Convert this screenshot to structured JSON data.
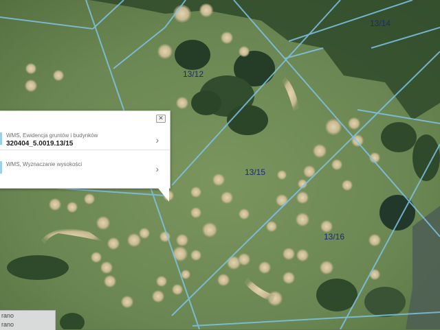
{
  "map": {
    "parcels": [
      {
        "id": "13/14",
        "label": "13/14"
      },
      {
        "id": "13/12",
        "label": "13/12"
      },
      {
        "id": "13/15",
        "label": "13/15"
      },
      {
        "id": "13/16",
        "label": "13/16"
      }
    ],
    "colors": {
      "boundary": "#7fc3e6",
      "label": "#1c2a6e",
      "grass": "#6d8a55",
      "forest": "#2f4a2a",
      "shrub": "#cdbf9a"
    }
  },
  "popup": {
    "close_icon": "close-icon",
    "items": [
      {
        "source": "WMS, Ewidencja gruntów i budynków",
        "value": "320404_5.0019.13/15",
        "icon": "chevron-right-icon"
      },
      {
        "source": "WMS, Wyznaczanie wysokości",
        "value": "",
        "icon": "chevron-right-icon"
      }
    ]
  },
  "layer_panel": {
    "rows": [
      "rano",
      "rano"
    ]
  }
}
